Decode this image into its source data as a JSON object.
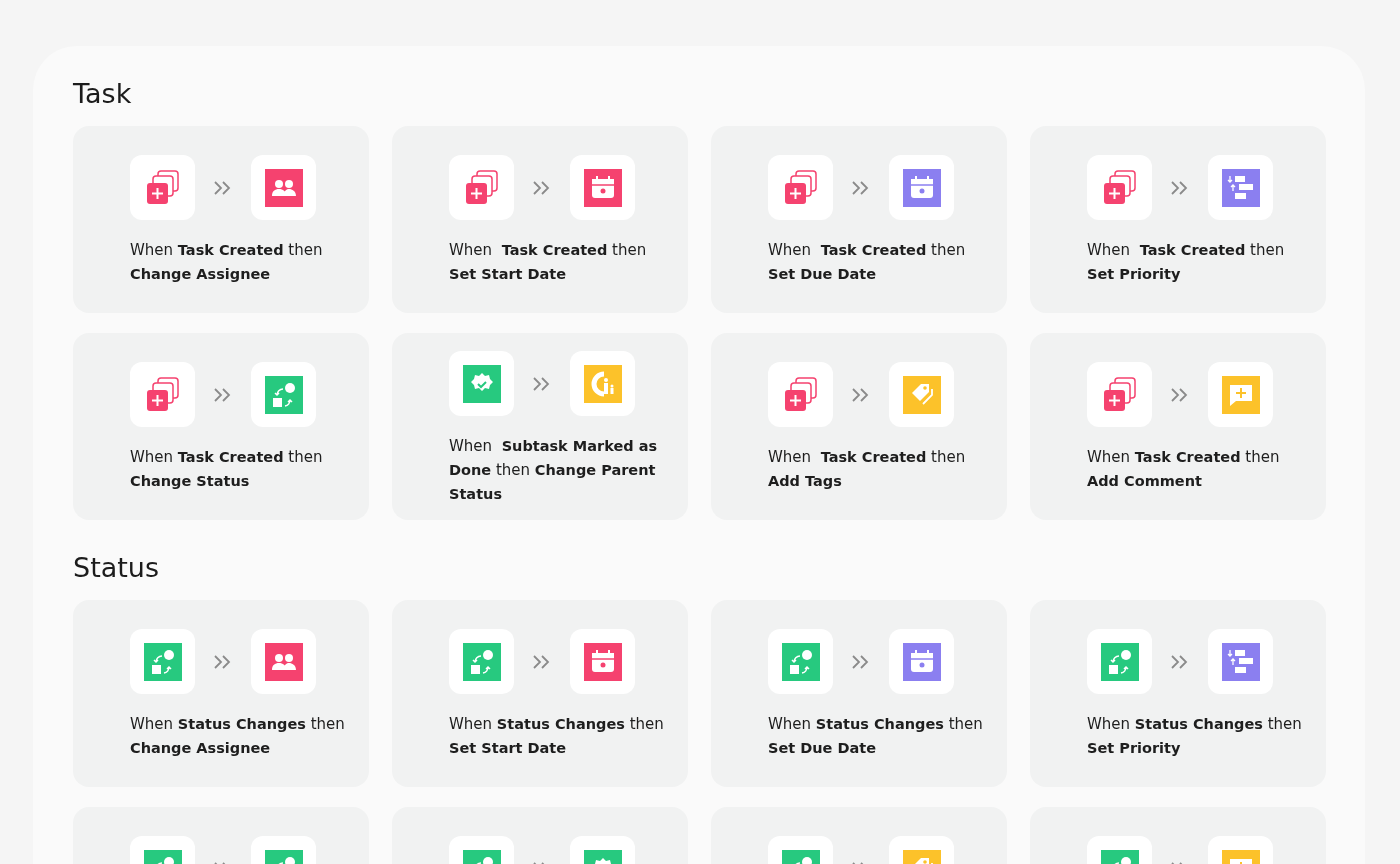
{
  "sections": [
    {
      "title": "Task",
      "cards": [
        {
          "trigger": {
            "kind": "task-created"
          },
          "action": {
            "kind": "assignee"
          },
          "text": "When **Task Created** then **Change Assignee**"
        },
        {
          "trigger": {
            "kind": "task-created"
          },
          "action": {
            "kind": "start-date"
          },
          "text": "When  **Task Created** then  **Set Start Date**"
        },
        {
          "trigger": {
            "kind": "task-created"
          },
          "action": {
            "kind": "due-date"
          },
          "text": "When  **Task Created** then **Set Due Date**"
        },
        {
          "trigger": {
            "kind": "task-created"
          },
          "action": {
            "kind": "priority"
          },
          "text": "When  **Task Created** then **Set Priority**"
        },
        {
          "trigger": {
            "kind": "task-created"
          },
          "action": {
            "kind": "status"
          },
          "text": "When **Task Created** then **Change Status**"
        },
        {
          "trigger": {
            "kind": "done"
          },
          "action": {
            "kind": "parent"
          },
          "text": "When  **Subtask Marked as Done** then **Change Parent Status**"
        },
        {
          "trigger": {
            "kind": "task-created"
          },
          "action": {
            "kind": "tags"
          },
          "text": "When  **Task Created** then **Add Tags**"
        },
        {
          "trigger": {
            "kind": "task-created"
          },
          "action": {
            "kind": "comment"
          },
          "text": "When **Task Created** then **Add Comment**"
        }
      ]
    },
    {
      "title": "Status",
      "cards": [
        {
          "trigger": {
            "kind": "status"
          },
          "action": {
            "kind": "assignee"
          },
          "text": "When **Status Changes** then **Change Assignee**"
        },
        {
          "trigger": {
            "kind": "status"
          },
          "action": {
            "kind": "start-date"
          },
          "text": "When **Status Changes** then **Set Start Date**"
        },
        {
          "trigger": {
            "kind": "status"
          },
          "action": {
            "kind": "due-date"
          },
          "text": "When **Status Changes** then **Set Due Date**"
        },
        {
          "trigger": {
            "kind": "status"
          },
          "action": {
            "kind": "priority"
          },
          "text": "When **Status Changes** then **Set Priority**"
        },
        {
          "trigger": {
            "kind": "status"
          },
          "action": {
            "kind": "status"
          }
        },
        {
          "trigger": {
            "kind": "status"
          },
          "action": {
            "kind": "done"
          }
        },
        {
          "trigger": {
            "kind": "status"
          },
          "action": {
            "kind": "tags"
          }
        },
        {
          "trigger": {
            "kind": "status"
          },
          "action": {
            "kind": "comment"
          }
        }
      ]
    }
  ]
}
